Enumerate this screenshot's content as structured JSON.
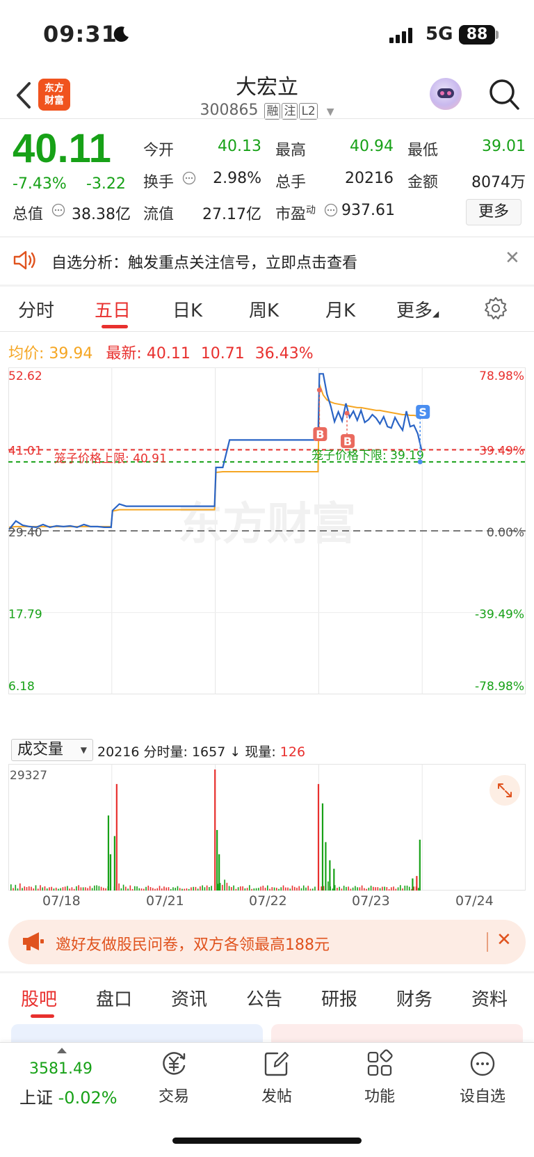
{
  "status_bar": {
    "time": "09:31",
    "network": "5G",
    "battery": "88"
  },
  "header": {
    "logo_text": "东方财富",
    "stock_name": "大宏立",
    "stock_code": "300865",
    "tags": [
      "融",
      "注",
      "L2"
    ]
  },
  "quote": {
    "price": "40.11",
    "change_pct": "-7.43%",
    "change_amt": "-3.22",
    "fields": [
      {
        "label": "今开",
        "value": "40.13",
        "color": "green"
      },
      {
        "label": "最高",
        "value": "40.94",
        "color": "green"
      },
      {
        "label": "最低",
        "value": "39.01",
        "color": "green"
      },
      {
        "label": "换手",
        "value": "2.98%",
        "color": "dark"
      },
      {
        "label": "总手",
        "value": "20216",
        "color": "dark"
      },
      {
        "label": "金额",
        "value": "8074万",
        "color": "dark"
      },
      {
        "label": "总值",
        "value": "38.38亿",
        "color": "dark"
      },
      {
        "label": "流值",
        "value": "27.17亿",
        "color": "dark"
      },
      {
        "label": "市盈",
        "sup": "动",
        "value": "937.61",
        "color": "dark"
      }
    ],
    "more_label": "更多"
  },
  "alert": {
    "text": "自选分析：触发重点关注信号，立即点击查看"
  },
  "tabs": {
    "items": [
      "分时",
      "五日",
      "日K",
      "周K",
      "月K",
      "更多"
    ],
    "active": "五日"
  },
  "chart_info": {
    "avg_label": "均价:",
    "avg_value": "39.94",
    "latest_label": "最新:",
    "latest_value": "40.11",
    "latest_chg": "10.71",
    "latest_pct": "36.43%"
  },
  "chart_data": {
    "type": "line",
    "title": "",
    "dates": [
      "07/18",
      "07/21",
      "07/22",
      "07/23",
      "07/24"
    ],
    "y_ticks_left": [
      "52.62",
      "41.01",
      "29.40",
      "17.79",
      "6.18"
    ],
    "y_ticks_right": [
      "78.98%",
      "39.49%",
      "0.00%",
      "-39.49%",
      "-78.98%"
    ],
    "ylim": [
      6.18,
      52.62
    ],
    "prev_close": 29.4,
    "upper_limit_label": "笼子价格上限: 40.91",
    "upper_limit": 40.91,
    "lower_limit_label": "笼子价格下限: 39.19",
    "lower_limit": 39.19,
    "watermark": "东方财富",
    "series": [
      {
        "name": "价格",
        "color": "#2a64c5",
        "values": [
          29.6,
          30.8,
          30.2,
          30.0,
          29.9,
          30.3,
          29.9,
          30.1,
          30.0,
          30.1,
          29.9,
          30.3,
          30.0,
          30.0,
          29.9,
          29.9,
          32.3,
          33.2,
          32.9,
          32.9,
          32.9,
          32.9,
          32.9,
          32.9,
          32.9,
          32.9,
          32.9,
          32.9,
          32.9,
          32.9,
          32.9,
          32.9,
          38.4,
          38.4,
          42.3,
          42.3,
          42.3,
          42.3,
          42.3,
          42.3,
          42.3,
          42.3,
          42.3,
          42.3,
          42.3,
          42.3,
          42.3,
          42.3,
          51.7,
          51.7,
          48.8,
          47.1,
          44.9,
          46.3,
          45.0,
          47.5,
          45.5,
          46.4,
          45.1,
          46.5,
          44.8,
          45.2,
          45.9,
          45.4,
          44.6,
          45.6,
          44.2,
          44.0,
          45.5,
          44.5,
          43.7,
          46.4,
          44.2,
          44.4,
          43.2,
          40.9
        ]
      },
      {
        "name": "均价",
        "color": "#f5a623",
        "values": [
          29.9,
          30.0,
          30.0,
          30.0,
          30.0,
          30.0,
          30.0,
          30.0,
          30.0,
          30.0,
          30.0,
          30.0,
          30.0,
          30.0,
          30.0,
          30.0,
          32.2,
          32.4,
          32.4,
          32.4,
          32.4,
          32.4,
          32.4,
          32.4,
          32.4,
          32.4,
          32.4,
          32.4,
          32.4,
          32.4,
          32.4,
          32.4,
          37.7,
          37.8,
          37.8,
          37.8,
          37.8,
          37.8,
          37.8,
          37.8,
          37.8,
          37.8,
          37.8,
          37.8,
          37.8,
          37.8,
          37.8,
          37.8,
          50.2,
          48.7,
          48.0,
          47.7,
          47.5,
          47.4,
          47.3,
          47.2,
          47.1,
          47.0,
          46.9,
          46.9,
          46.8,
          46.7,
          46.6,
          46.5,
          46.5,
          46.4,
          46.3,
          46.2,
          46.1,
          46.0,
          45.9,
          45.9,
          45.8,
          45.8,
          45.7,
          45.7
        ]
      }
    ],
    "markers": [
      {
        "label": "B",
        "day": 3,
        "pos": 0.0,
        "price": 49.0
      },
      {
        "label": "B",
        "day": 3,
        "pos": 0.27,
        "price": 45.7
      },
      {
        "label": "S",
        "day": 3,
        "pos": 1.0,
        "price": 42.8
      }
    ]
  },
  "volume": {
    "selector": "成交量",
    "total": "20216",
    "minute_label": "分时量:",
    "minute_value": "1657",
    "arrow": "↓",
    "current_label": "现量:",
    "current_value": "126",
    "max_tick": "29327"
  },
  "promo": {
    "text": "邀好友做股民问卷，双方各领最高188元"
  },
  "bottom_tabs": {
    "items": [
      "股吧",
      "盘口",
      "资讯",
      "公告",
      "研报",
      "财务",
      "资料"
    ],
    "active": "股吧"
  },
  "bottom_nav": {
    "index_value": "3581.49",
    "index_name": "上证",
    "index_change": "-0.02%",
    "items": [
      {
        "label": "交易",
        "icon": "trade-icon"
      },
      {
        "label": "发帖",
        "icon": "post-icon"
      },
      {
        "label": "功能",
        "icon": "grid-icon"
      },
      {
        "label": "设自选",
        "icon": "watchlist-icon"
      }
    ]
  },
  "colors": {
    "up": "#e8302e",
    "down": "#17a117",
    "price_line": "#2a64c5",
    "avg_line": "#f5a623",
    "accent": "#e8302e"
  }
}
